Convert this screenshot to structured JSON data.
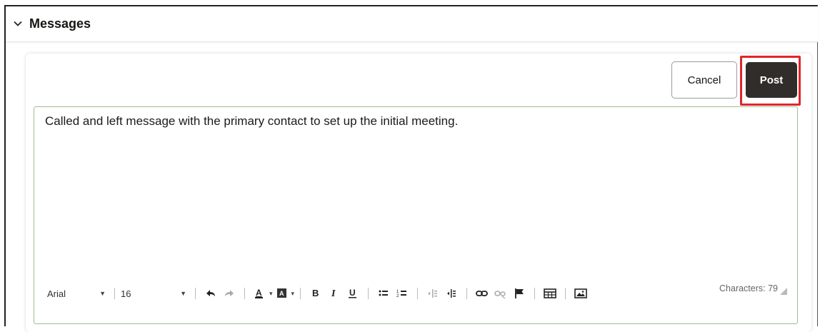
{
  "section": {
    "title": "Messages"
  },
  "actions": {
    "cancel_label": "Cancel",
    "post_label": "Post"
  },
  "editor": {
    "text": "Called and left message with the primary contact to set up the initial meeting.",
    "font_name": "Arial",
    "font_size": "16",
    "char_count_label": "Characters: 79"
  },
  "toolbar": {
    "icons": [
      "undo-icon",
      "redo-icon",
      "text-color-icon",
      "background-color-icon",
      "bold-icon",
      "italic-icon",
      "underline-icon",
      "bulleted-list-icon",
      "numbered-list-icon",
      "outdent-icon",
      "indent-icon",
      "link-icon",
      "unlink-icon",
      "flag-icon",
      "table-icon",
      "image-icon"
    ]
  },
  "colors": {
    "post_bg": "#312d2a",
    "highlight": "#e0252b",
    "editor_border": "#a3bc8e"
  }
}
